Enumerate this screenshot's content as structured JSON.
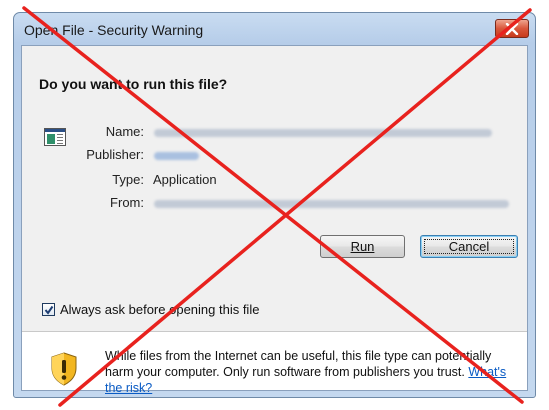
{
  "window": {
    "title": "Open File - Security Warning",
    "close_icon": "close-icon"
  },
  "question": "Do you want to run this file?",
  "fields": {
    "name_label": "Name:",
    "publisher_label": "Publisher:",
    "type_label": "Type:",
    "type_value": "Application",
    "from_label": "From:"
  },
  "buttons": {
    "run_label": "Run",
    "cancel_label": "Cancel"
  },
  "checkbox": {
    "label": "Always ask before opening this file",
    "checked": true
  },
  "footer": {
    "text": "While files from the Internet can be useful, this file type can potentially harm your computer. Only run software from publishers you trust.",
    "link": "What's the risk?"
  },
  "icons": [
    "application-icon",
    "shield-warning-icon",
    "close-icon",
    "checkmark-icon"
  ],
  "colors": {
    "overlay_x": "#e8221e",
    "link": "#0a5bc4",
    "shield_yellow": "#f2b620"
  }
}
